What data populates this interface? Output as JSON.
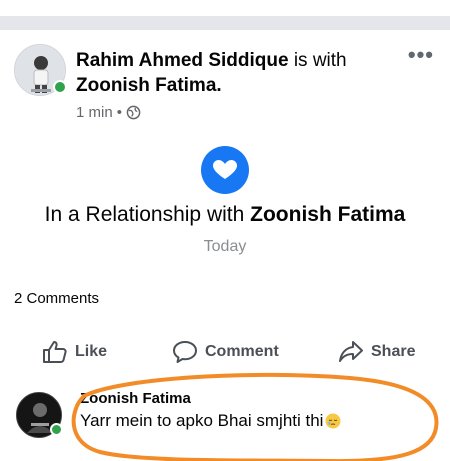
{
  "post": {
    "author": "Rahim Ahmed Siddique",
    "connector": "is with",
    "tagged": "Zoonish Fatima.",
    "time": "1 min",
    "separator": "•",
    "privacy_icon": "globe-icon",
    "more_icon": "•••"
  },
  "life_event": {
    "icon": "heart-icon",
    "prefix": "In a Relationship with",
    "partner": "Zoonish Fatima",
    "date": "Today"
  },
  "stats": {
    "comments": "2 Comments"
  },
  "actions": {
    "like": "Like",
    "comment": "Comment",
    "share": "Share"
  },
  "comment": {
    "author": "Zoonish Fatima",
    "text": "Yarr mein to apko Bhai smjhti thi",
    "emoji": "sleepy-face-emoji"
  },
  "colors": {
    "accent": "#1877f2",
    "online": "#31a24c",
    "highlight": "#f28c28"
  }
}
